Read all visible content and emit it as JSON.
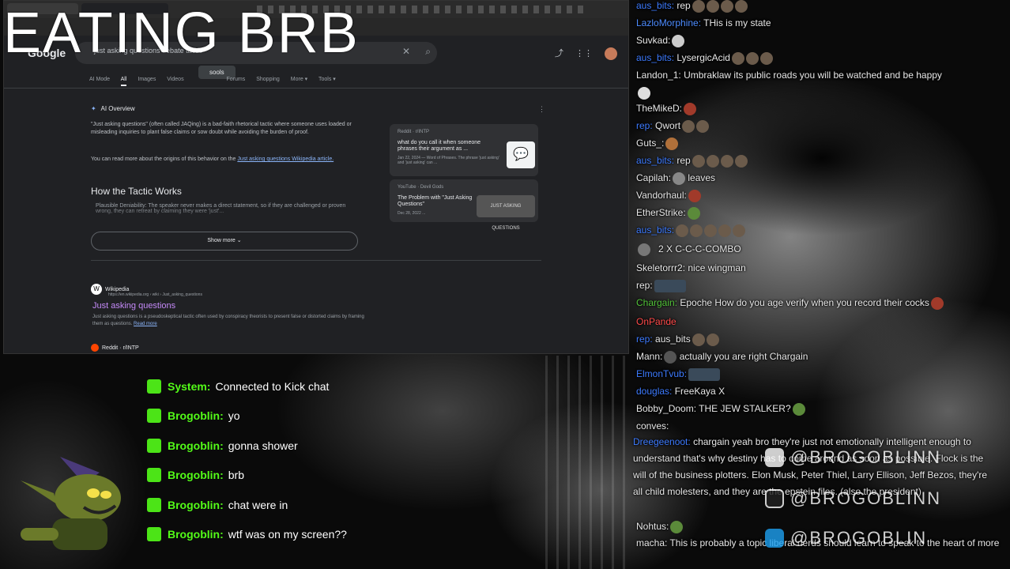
{
  "overlay": {
    "brb_text": "EATING  BRB"
  },
  "google": {
    "logo": "Google",
    "query": "just asking questions debate tactic",
    "tooltip": "sools",
    "tabs": [
      "AI Mode",
      "All",
      "Images",
      "Videos",
      "Forums",
      "Shopping",
      "More ▾",
      "Tools ▾"
    ],
    "ai_overview_label": "AI Overview",
    "ai_para1": "\"Just asking questions\" (often called JAQing) is a bad-faith rhetorical tactic where someone uses loaded or misleading inquiries to plant false claims or sow doubt while avoiding the burden of proof.",
    "ai_para2_prefix": "You can read more about the origins of this behavior on the ",
    "ai_para2_link": "Just asking questions Wikipedia article.",
    "ai_heading": "How the Tactic Works",
    "ai_bullet": "Plausible Deniability: The speaker never makes a direct statement, so if they are challenged or proven wrong, they can retreat by claiming they were 'just'...",
    "show_more": "Show more ⌄",
    "card1": {
      "source": "Reddit · r/INTP",
      "title": "what do you call it when someone phrases their argument as ...",
      "snippet": "Jan 22, 2024 — Word of Phrases. The phrase 'just asking' and 'just asking' can ..."
    },
    "card2": {
      "source": "YouTube · Devil Gods",
      "title": "The Problem with \"Just Asking Questions\"",
      "snippet": "Dec 28, 2022 ...",
      "thumb_text": "JUST ASKING QUESTIONS"
    },
    "wiki_source": "Wikipedia",
    "wiki_url": "https://en.wikipedia.org › wiki › Just_asking_questions",
    "wiki_title": "Just asking questions",
    "wiki_snippet": "Just asking questions is a pseudoskeptical tactic often used by conspiracy theorists to present false or distorted claims by framing them as questions.",
    "wiki_read_more": "Read more",
    "reddit_source": "Reddit · r/INTP"
  },
  "kick_chat": [
    {
      "name": "System:",
      "text": "Connected to Kick chat"
    },
    {
      "name": "Brogoblin:",
      "text": "yo"
    },
    {
      "name": "Brogoblin:",
      "text": "gonna shower"
    },
    {
      "name": "Brogoblin:",
      "text": "brb"
    },
    {
      "name": "Brogoblin:",
      "text": "chat were in"
    },
    {
      "name": "Brogoblin:",
      "text": "wtf was on my screen??"
    }
  ],
  "chat": [
    {
      "name": "aus_bits:",
      "color": "#3d7bff",
      "text": " rep"
    },
    {
      "name": "LazloMorphine:",
      "color": "#4d8cff",
      "text": " THis is my state"
    },
    {
      "name": "Suvkad:",
      "color": "#e8e8e8",
      "text": ""
    },
    {
      "name": "aus_bits:",
      "color": "#3d7bff",
      "text": " LysergicAcid"
    },
    {
      "name": "Landon_1:",
      "color": "#e8e8e8",
      "text": " Umbraklaw  its public roads you will be watched and be happy"
    },
    {
      "name": "TheMikeD:",
      "color": "#e8e8e8",
      "text": ""
    },
    {
      "name": "rep:",
      "color": "#3d7bff",
      "text": " Qwort"
    },
    {
      "name": "Guts_:",
      "color": "#e8e8e8",
      "text": ""
    },
    {
      "name": "aus_bits:",
      "color": "#3d7bff",
      "text": " rep"
    },
    {
      "name": "Capilah:",
      "color": "#e8e8e8",
      "text": " leaves"
    },
    {
      "name": "Vandorhaul:",
      "color": "#e8e8e8",
      "text": ""
    },
    {
      "name": "EtherStrike:",
      "color": "#e8e8e8",
      "text": ""
    },
    {
      "name": "aus_bits:",
      "color": "#3d7bff",
      "text": ""
    },
    {
      "name": "",
      "color": "#e8e8e8",
      "text": "2 X C-C-C-COMBO"
    },
    {
      "name": "Skeletorrr2:",
      "color": "#e8e8e8",
      "text": " nice wingman"
    },
    {
      "name": "rep:",
      "color": "#e8e8e8",
      "text": ""
    },
    {
      "name": "Chargain:",
      "color": "#53c43a",
      "text": " Epoche How do you age verify when you record their cocks"
    },
    {
      "name": "OnPande",
      "color": "#ff4a4a",
      "text": ""
    },
    {
      "name": "rep:",
      "color": "#3d7bff",
      "text": " aus_bits"
    },
    {
      "name": "Mann:",
      "color": "#e8e8e8",
      "text": "  actually you are right  Chargain"
    },
    {
      "name": "ElmonTvub:",
      "color": "#3d7bff",
      "text": ""
    },
    {
      "name": "douglas:",
      "color": "#3d7bff",
      "text": " FreeKaya X"
    },
    {
      "name": "Bobby_Doom:",
      "color": "#e8e8e8",
      "text": " THE JEW STALKER?"
    },
    {
      "name": "conves:",
      "color": "#e8e8e8",
      "text": ""
    }
  ],
  "chat_wrapped": [
    {
      "name": "Dreegeenoot:",
      "color": "#3d7bff",
      "text": " chargain yeah bro they're just not emotionally intelligent enough to understand  that's why destiny has to come around as soon as possible. Flock is the will of the business plotters. Elon Musk, Peter Thiel, Larry Ellison, Jeff Bezos, they're all child molesters, and they are the epstein files. (also the president)"
    },
    {
      "name": "Nohtus:",
      "color": "#e8e8e8",
      "text": ""
    },
    {
      "name": "macha:",
      "color": "#e8e8e8",
      "text": " This is probably a topic liberal nerds should learn to speak to the heart of more"
    }
  ],
  "social": {
    "youtube": "@BROGOBLINN",
    "instagram": "@BROGOBLINN",
    "twitter": "@BROGOBLIN"
  }
}
